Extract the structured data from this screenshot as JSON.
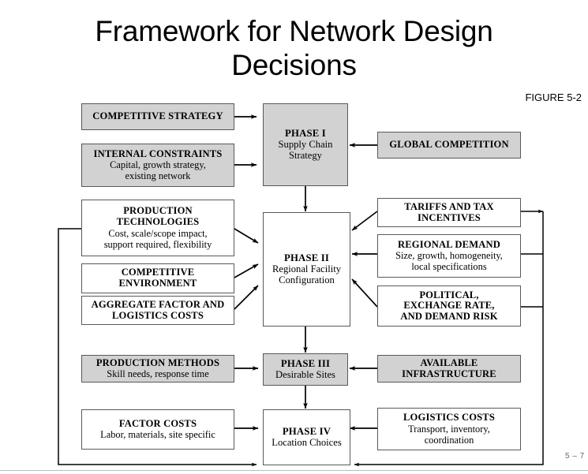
{
  "slide": {
    "title": "Framework for Network Design Decisions",
    "figure_label": "FIGURE 5-2",
    "page_number": "5 – 7"
  },
  "colors": {
    "shaded_fill": "#d2d2d2",
    "box_border": "#595959",
    "wire": "#000000",
    "page_number_text": "#6a6a6a"
  },
  "boxes": {
    "competitive_strategy": {
      "title": "COMPETITIVE STRATEGY",
      "detail": ""
    },
    "internal_constraints": {
      "title": "INTERNAL CONSTRAINTS",
      "detail_1": "Capital, growth strategy,",
      "detail_2": "existing network"
    },
    "phase1": {
      "title": "PHASE I",
      "detail_1": "Supply Chain",
      "detail_2": "Strategy"
    },
    "global_competition": {
      "title": "GLOBAL COMPETITION",
      "detail": ""
    },
    "production_technologies": {
      "title_1": "PRODUCTION",
      "title_2": "TECHNOLOGIES",
      "detail_1": "Cost, scale/scope impact,",
      "detail_2": "support required, flexibility"
    },
    "competitive_environment": {
      "title_1": "COMPETITIVE",
      "title_2": "ENVIRONMENT"
    },
    "aggregate_factor": {
      "title_1": "AGGREGATE FACTOR AND",
      "title_2": "LOGISTICS COSTS"
    },
    "phase2": {
      "title": "PHASE II",
      "detail_1": "Regional Facility",
      "detail_2": "Configuration"
    },
    "tariffs": {
      "title_1": "TARIFFS AND TAX",
      "title_2": "INCENTIVES"
    },
    "regional_demand": {
      "title": "REGIONAL DEMAND",
      "detail_1": "Size, growth, homogeneity,",
      "detail_2": "local specifications"
    },
    "political": {
      "title_1": "POLITICAL,",
      "title_2": "EXCHANGE RATE,",
      "title_3": "AND DEMAND RISK"
    },
    "production_methods": {
      "title": "PRODUCTION METHODS",
      "detail": "Skill needs, response time"
    },
    "phase3": {
      "title": "PHASE III",
      "detail": "Desirable Sites"
    },
    "available_infrastructure": {
      "title_1": "AVAILABLE",
      "title_2": "INFRASTRUCTURE"
    },
    "factor_costs": {
      "title": "FACTOR COSTS",
      "detail": "Labor, materials, site specific"
    },
    "phase4": {
      "title": "PHASE IV",
      "detail": "Location Choices"
    },
    "logistics_costs": {
      "title": "LOGISTICS COSTS",
      "detail_1": "Transport, inventory,",
      "detail_2": "coordination"
    }
  }
}
